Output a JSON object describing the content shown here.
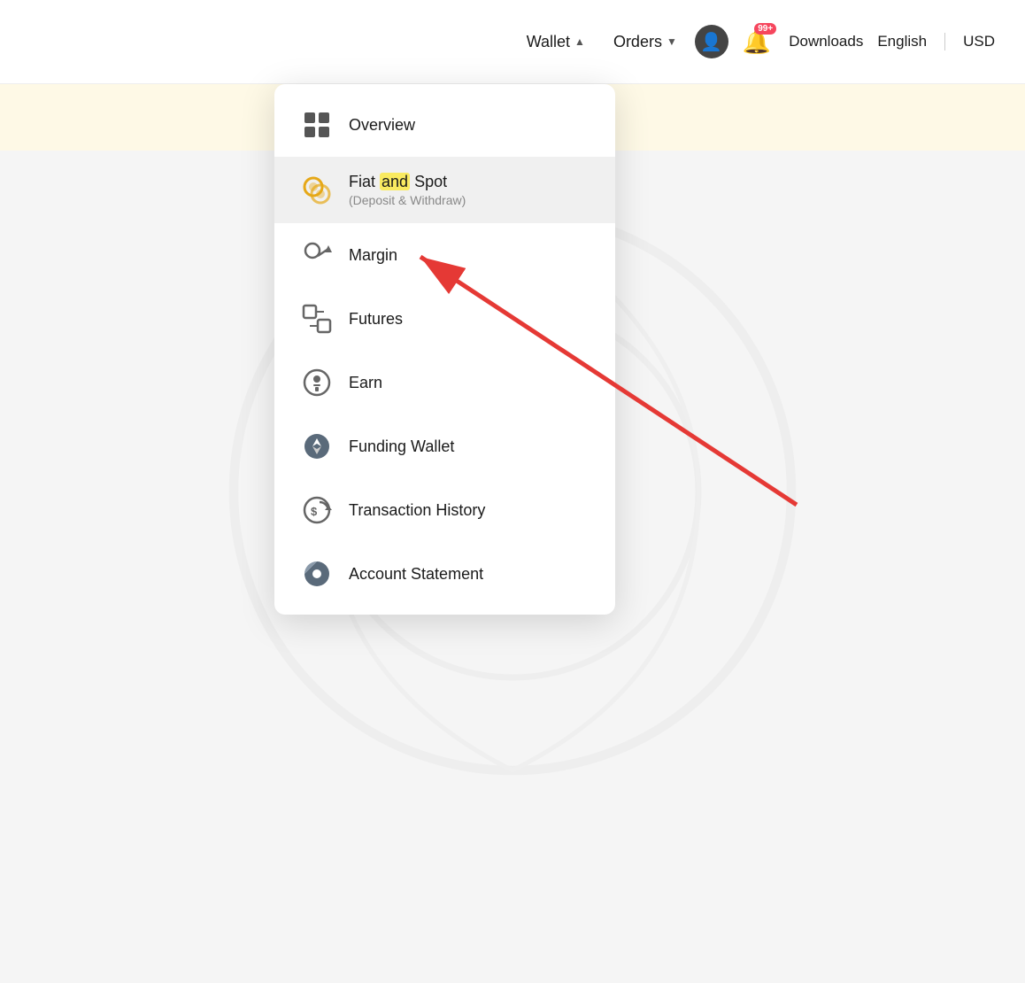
{
  "navbar": {
    "wallet_label": "Wallet",
    "orders_label": "Orders",
    "downloads_label": "Downloads",
    "english_label": "English",
    "usd_label": "USD",
    "notification_badge": "99+"
  },
  "dropdown": {
    "items": [
      {
        "id": "overview",
        "label": "Overview",
        "sublabel": null,
        "icon": "grid"
      },
      {
        "id": "fiat-and-spot",
        "label": "Fiat and Spot",
        "sublabel": "(Deposit & Withdraw)",
        "icon": "fiat"
      },
      {
        "id": "margin",
        "label": "Margin",
        "sublabel": null,
        "icon": "margin"
      },
      {
        "id": "futures",
        "label": "Futures",
        "sublabel": null,
        "icon": "futures"
      },
      {
        "id": "earn",
        "label": "Earn",
        "sublabel": null,
        "icon": "earn"
      },
      {
        "id": "funding-wallet",
        "label": "Funding Wallet",
        "sublabel": null,
        "icon": "funding"
      },
      {
        "id": "transaction-history",
        "label": "Transaction History",
        "sublabel": null,
        "icon": "transaction"
      },
      {
        "id": "account-statement",
        "label": "Account Statement",
        "sublabel": null,
        "icon": "statement"
      }
    ]
  }
}
